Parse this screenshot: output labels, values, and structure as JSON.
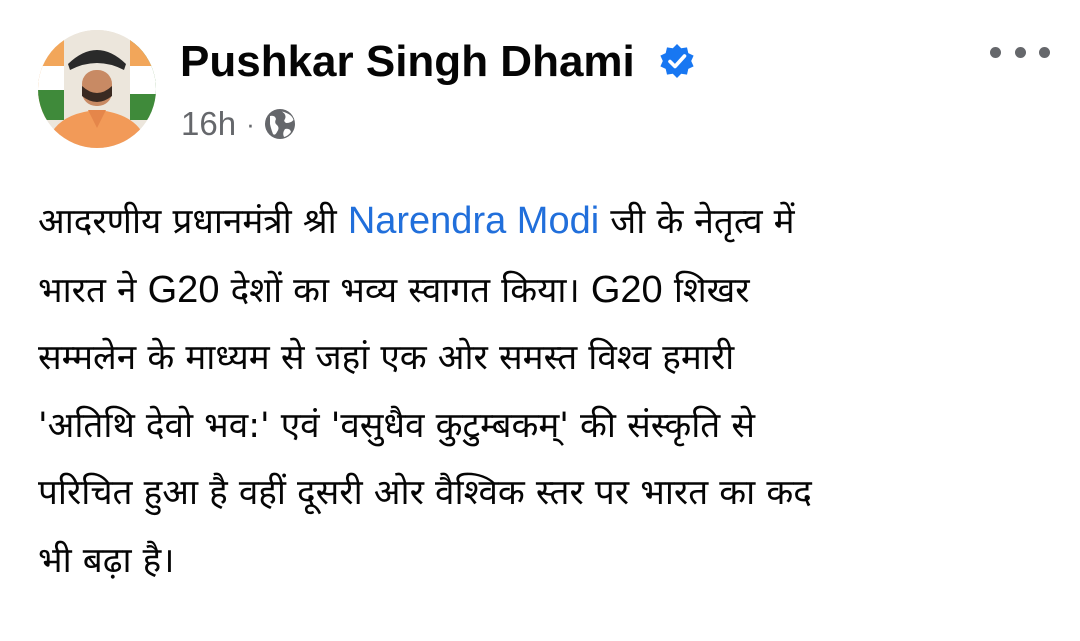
{
  "post": {
    "author": "Pushkar Singh Dhami",
    "verified": true,
    "timestamp": "16h",
    "separator": "·",
    "audience_icon": "globe-icon",
    "more_icon": "more-horizontal-icon",
    "text": {
      "line1_before": "आदरणीय प्रधानमंत्री श्री ",
      "mention": "Narendra Modi",
      "line1_after": " जी के नेतृत्व में",
      "line2_a": "भारत ने ",
      "line2_b": "G20",
      "line2_c": " देशों का भव्य स्वागत किया। ",
      "line2_d": "G20",
      "line2_e": " शिखर",
      "line3": "सम्मलेन के माध्यम से जहां एक ओर समस्त विश्व हमारी",
      "line4": "'अतिथि देवो भव:' एवं 'वसुधैव कुटुम्बकम्' की संस्कृति से",
      "line5": "परिचित हुआ है वहीं दूसरी ओर वैश्विक स्तर पर भारत का कद",
      "line6": "भी बढ़ा है।"
    }
  },
  "colors": {
    "mention": "#216fdb",
    "secondary_text": "#65676b",
    "verified_badge": "#1877f2",
    "primary_text": "#050505"
  }
}
